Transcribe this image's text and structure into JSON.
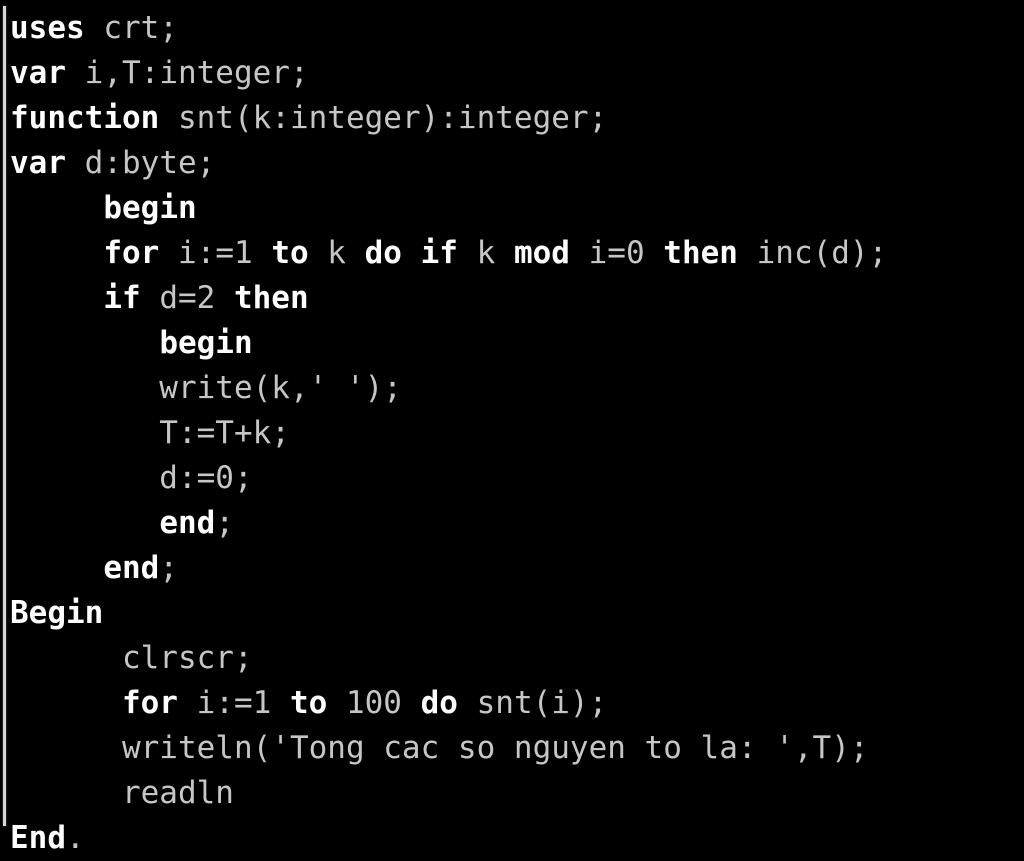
{
  "screen": {
    "background_color": "#000000",
    "foreground_keyword_color": "#ffffff",
    "foreground_identifier_color": "#c6c6c6",
    "border_color": "#d8d8d8",
    "language": "Pascal",
    "total_lines": 18
  },
  "code": {
    "lines": [
      {
        "indent": "",
        "text": "uses crt;"
      },
      {
        "indent": "",
        "text": "var i,T:integer;"
      },
      {
        "indent": "",
        "text": "function snt(k:integer):integer;"
      },
      {
        "indent": "",
        "text": "var d:byte;"
      },
      {
        "indent": "     ",
        "text": "begin"
      },
      {
        "indent": "     ",
        "text": "for i:=1 to k do if k mod i=0 then inc(d);"
      },
      {
        "indent": "     ",
        "text": "if d=2 then"
      },
      {
        "indent": "        ",
        "text": "begin"
      },
      {
        "indent": "        ",
        "text": "write(k,' ');"
      },
      {
        "indent": "        ",
        "text": "T:=T+k;"
      },
      {
        "indent": "        ",
        "text": "d:=0;"
      },
      {
        "indent": "        ",
        "text": "end;"
      },
      {
        "indent": "     ",
        "text": "end;"
      },
      {
        "indent": "",
        "text": "Begin"
      },
      {
        "indent": "      ",
        "text": "clrscr;"
      },
      {
        "indent": "      ",
        "text": "for i:=1 to 100 do snt(i);"
      },
      {
        "indent": "      ",
        "text": "writeln('Tong cac so nguyen to la: ',T);"
      },
      {
        "indent": "      ",
        "text": "readln"
      },
      {
        "indent": "",
        "text": "End."
      }
    ],
    "full_source": "uses crt;\nvar i,T:integer;\nfunction snt(k:integer):integer;\nvar d:byte;\n     begin\n     for i:=1 to k do if k mod i=0 then inc(d);\n     if d=2 then\n        begin\n        write(k,' ');\n        T:=T+k;\n        d:=0;\n        end;\n     end;\nBegin\n      clrscr;\n      for i:=1 to 100 do snt(i);\n      writeln('Tong cac so nguyen to la: ',T);\n      readln\nEnd.",
    "keywords": [
      "uses",
      "var",
      "function",
      "begin",
      "end",
      "for",
      "to",
      "do",
      "if",
      "then",
      "mod",
      "Begin",
      "End"
    ],
    "string_literals": [
      "' '",
      "'Tong cac so nguyen to la: '"
    ],
    "identifiers": [
      "crt",
      "i",
      "T",
      "integer",
      "snt",
      "k",
      "d",
      "byte",
      "inc",
      "write",
      "clrscr",
      "writeln",
      "readln"
    ],
    "numbers": [
      "1",
      "0",
      "2",
      "100"
    ]
  }
}
